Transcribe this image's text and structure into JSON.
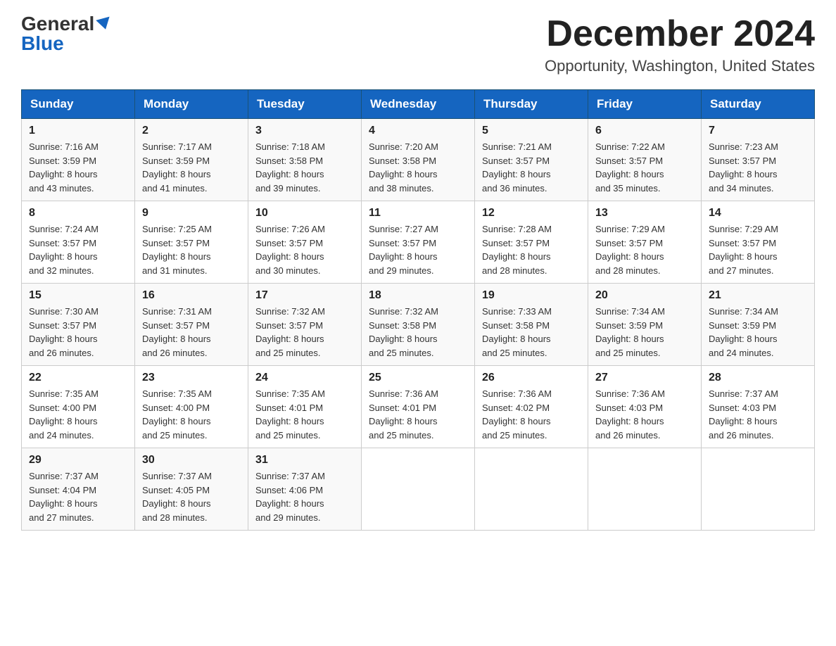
{
  "header": {
    "logo_general": "General",
    "logo_blue": "Blue",
    "month_title": "December 2024",
    "location": "Opportunity, Washington, United States"
  },
  "days_of_week": [
    "Sunday",
    "Monday",
    "Tuesday",
    "Wednesday",
    "Thursday",
    "Friday",
    "Saturday"
  ],
  "weeks": [
    [
      {
        "day": "1",
        "sunrise": "7:16 AM",
        "sunset": "3:59 PM",
        "daylight": "8 hours and 43 minutes."
      },
      {
        "day": "2",
        "sunrise": "7:17 AM",
        "sunset": "3:59 PM",
        "daylight": "8 hours and 41 minutes."
      },
      {
        "day": "3",
        "sunrise": "7:18 AM",
        "sunset": "3:58 PM",
        "daylight": "8 hours and 39 minutes."
      },
      {
        "day": "4",
        "sunrise": "7:20 AM",
        "sunset": "3:58 PM",
        "daylight": "8 hours and 38 minutes."
      },
      {
        "day": "5",
        "sunrise": "7:21 AM",
        "sunset": "3:57 PM",
        "daylight": "8 hours and 36 minutes."
      },
      {
        "day": "6",
        "sunrise": "7:22 AM",
        "sunset": "3:57 PM",
        "daylight": "8 hours and 35 minutes."
      },
      {
        "day": "7",
        "sunrise": "7:23 AM",
        "sunset": "3:57 PM",
        "daylight": "8 hours and 34 minutes."
      }
    ],
    [
      {
        "day": "8",
        "sunrise": "7:24 AM",
        "sunset": "3:57 PM",
        "daylight": "8 hours and 32 minutes."
      },
      {
        "day": "9",
        "sunrise": "7:25 AM",
        "sunset": "3:57 PM",
        "daylight": "8 hours and 31 minutes."
      },
      {
        "day": "10",
        "sunrise": "7:26 AM",
        "sunset": "3:57 PM",
        "daylight": "8 hours and 30 minutes."
      },
      {
        "day": "11",
        "sunrise": "7:27 AM",
        "sunset": "3:57 PM",
        "daylight": "8 hours and 29 minutes."
      },
      {
        "day": "12",
        "sunrise": "7:28 AM",
        "sunset": "3:57 PM",
        "daylight": "8 hours and 28 minutes."
      },
      {
        "day": "13",
        "sunrise": "7:29 AM",
        "sunset": "3:57 PM",
        "daylight": "8 hours and 28 minutes."
      },
      {
        "day": "14",
        "sunrise": "7:29 AM",
        "sunset": "3:57 PM",
        "daylight": "8 hours and 27 minutes."
      }
    ],
    [
      {
        "day": "15",
        "sunrise": "7:30 AM",
        "sunset": "3:57 PM",
        "daylight": "8 hours and 26 minutes."
      },
      {
        "day": "16",
        "sunrise": "7:31 AM",
        "sunset": "3:57 PM",
        "daylight": "8 hours and 26 minutes."
      },
      {
        "day": "17",
        "sunrise": "7:32 AM",
        "sunset": "3:57 PM",
        "daylight": "8 hours and 25 minutes."
      },
      {
        "day": "18",
        "sunrise": "7:32 AM",
        "sunset": "3:58 PM",
        "daylight": "8 hours and 25 minutes."
      },
      {
        "day": "19",
        "sunrise": "7:33 AM",
        "sunset": "3:58 PM",
        "daylight": "8 hours and 25 minutes."
      },
      {
        "day": "20",
        "sunrise": "7:34 AM",
        "sunset": "3:59 PM",
        "daylight": "8 hours and 25 minutes."
      },
      {
        "day": "21",
        "sunrise": "7:34 AM",
        "sunset": "3:59 PM",
        "daylight": "8 hours and 24 minutes."
      }
    ],
    [
      {
        "day": "22",
        "sunrise": "7:35 AM",
        "sunset": "4:00 PM",
        "daylight": "8 hours and 24 minutes."
      },
      {
        "day": "23",
        "sunrise": "7:35 AM",
        "sunset": "4:00 PM",
        "daylight": "8 hours and 25 minutes."
      },
      {
        "day": "24",
        "sunrise": "7:35 AM",
        "sunset": "4:01 PM",
        "daylight": "8 hours and 25 minutes."
      },
      {
        "day": "25",
        "sunrise": "7:36 AM",
        "sunset": "4:01 PM",
        "daylight": "8 hours and 25 minutes."
      },
      {
        "day": "26",
        "sunrise": "7:36 AM",
        "sunset": "4:02 PM",
        "daylight": "8 hours and 25 minutes."
      },
      {
        "day": "27",
        "sunrise": "7:36 AM",
        "sunset": "4:03 PM",
        "daylight": "8 hours and 26 minutes."
      },
      {
        "day": "28",
        "sunrise": "7:37 AM",
        "sunset": "4:03 PM",
        "daylight": "8 hours and 26 minutes."
      }
    ],
    [
      {
        "day": "29",
        "sunrise": "7:37 AM",
        "sunset": "4:04 PM",
        "daylight": "8 hours and 27 minutes."
      },
      {
        "day": "30",
        "sunrise": "7:37 AM",
        "sunset": "4:05 PM",
        "daylight": "8 hours and 28 minutes."
      },
      {
        "day": "31",
        "sunrise": "7:37 AM",
        "sunset": "4:06 PM",
        "daylight": "8 hours and 29 minutes."
      },
      null,
      null,
      null,
      null
    ]
  ],
  "labels": {
    "sunrise": "Sunrise: ",
    "sunset": "Sunset: ",
    "daylight": "Daylight: "
  }
}
